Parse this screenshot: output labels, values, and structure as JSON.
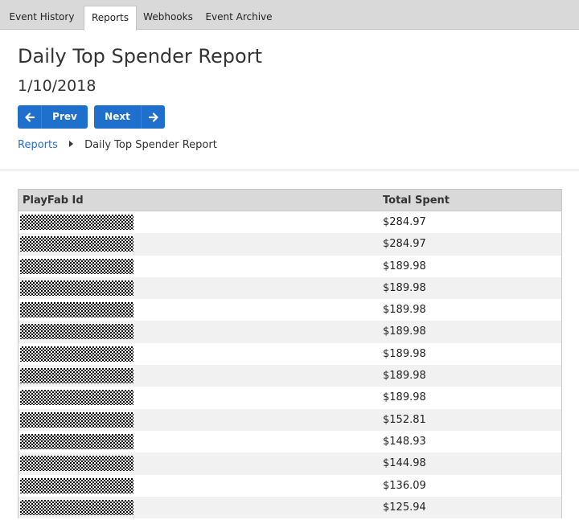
{
  "tabs": [
    {
      "label": "Event History",
      "active": false
    },
    {
      "label": "Reports",
      "active": true
    },
    {
      "label": "Webhooks",
      "active": false
    },
    {
      "label": "Event Archive",
      "active": false
    }
  ],
  "page": {
    "title": "Daily Top Spender Report",
    "date": "1/10/2018"
  },
  "nav": {
    "prev_label": "Prev",
    "next_label": "Next",
    "prev_icon": "arrow-left-icon",
    "next_icon": "arrow-right-icon"
  },
  "breadcrumb": {
    "root": "Reports",
    "current": "Daily Top Spender Report"
  },
  "table": {
    "headers": {
      "id": "PlayFab Id",
      "total": "Total Spent"
    },
    "rows": [
      {
        "total": "$284.97"
      },
      {
        "total": "$284.97"
      },
      {
        "total": "$189.98"
      },
      {
        "total": "$189.98"
      },
      {
        "total": "$189.98"
      },
      {
        "total": "$189.98"
      },
      {
        "total": "$189.98"
      },
      {
        "total": "$189.98"
      },
      {
        "total": "$189.98"
      },
      {
        "total": "$152.81"
      },
      {
        "total": "$148.93"
      },
      {
        "total": "$144.98"
      },
      {
        "total": "$136.09"
      },
      {
        "total": "$125.94"
      }
    ]
  },
  "colors": {
    "tab_bar": "#d9d9d9",
    "button": "#1f6fcc",
    "link": "#2a6fc9",
    "table_header": "#d9d9d9",
    "row_alt": "#f1f1f1"
  }
}
